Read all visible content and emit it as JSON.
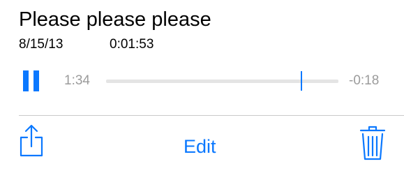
{
  "memo": {
    "title": "Please please please",
    "date": "8/15/13",
    "duration": "0:01:53"
  },
  "player": {
    "state": "playing",
    "elapsed": "1:34",
    "remaining": "-0:18",
    "progress_fraction": 0.84
  },
  "toolbar": {
    "share_icon": "share-icon",
    "edit_label": "Edit",
    "trash_icon": "trash-icon"
  },
  "colors": {
    "accent": "#0a78ff",
    "secondary_text": "#9b9b9b",
    "track": "#e4e4e4",
    "divider": "#c9c9c9"
  }
}
